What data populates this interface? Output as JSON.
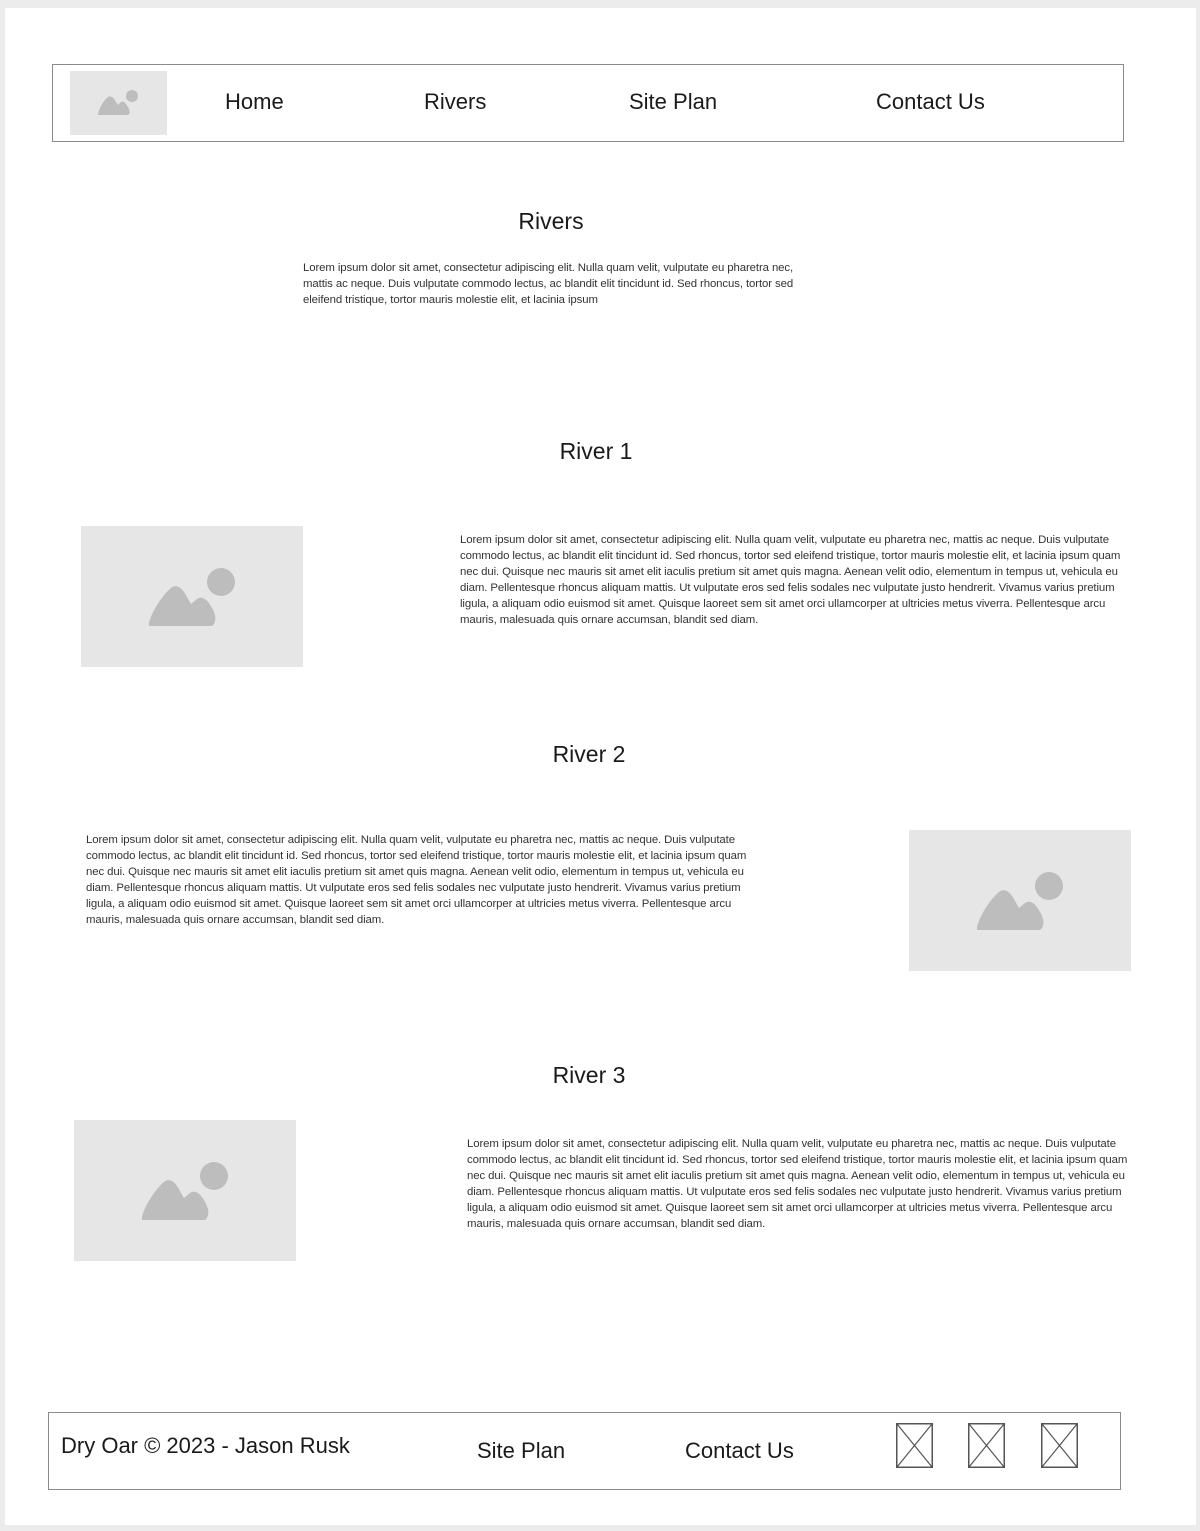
{
  "nav": {
    "links": [
      "Home",
      "Rivers",
      "Site Plan",
      "Contact Us"
    ],
    "logo_icon": "image-placeholder-icon"
  },
  "intro": {
    "title": "Rivers",
    "text": "Lorem ipsum dolor sit amet, consectetur adipiscing elit. Nulla quam velit, vulputate eu pharetra nec, mattis ac neque. Duis vulputate commodo lectus, ac blandit elit tincidunt id. Sed rhoncus, tortor sed eleifend tristique, tortor mauris molestie elit, et lacinia ipsum"
  },
  "rivers": [
    {
      "title": "River 1",
      "text": "Lorem ipsum dolor sit amet, consectetur adipiscing elit. Nulla quam velit, vulputate eu pharetra nec, mattis ac neque. Duis vulputate commodo lectus, ac blandit elit tincidunt id. Sed rhoncus, tortor sed eleifend tristique, tortor mauris molestie elit, et lacinia ipsum quam nec dui. Quisque nec mauris sit amet elit iaculis pretium sit amet quis magna. Aenean velit odio, elementum in tempus ut, vehicula eu diam. Pellentesque rhoncus aliquam mattis. Ut vulputate eros sed felis sodales nec vulputate justo hendrerit. Vivamus varius pretium ligula, a aliquam odio euismod sit amet. Quisque laoreet sem sit amet orci ullamcorper at ultricies metus viverra. Pellentesque arcu mauris, malesuada quis ornare accumsan, blandit sed diam."
    },
    {
      "title": "River 2",
      "text": "Lorem ipsum dolor sit amet, consectetur adipiscing elit. Nulla quam velit, vulputate eu pharetra nec, mattis ac neque. Duis vulputate commodo lectus, ac blandit elit tincidunt id. Sed rhoncus, tortor sed eleifend tristique, tortor mauris molestie elit, et lacinia ipsum quam nec dui. Quisque nec mauris sit amet elit iaculis pretium sit amet quis magna. Aenean velit odio, elementum in tempus ut, vehicula eu diam. Pellentesque rhoncus aliquam mattis. Ut vulputate eros sed felis sodales nec vulputate justo hendrerit. Vivamus varius pretium ligula, a aliquam odio euismod sit amet. Quisque laoreet sem sit amet orci ullamcorper at ultricies metus viverra. Pellentesque arcu mauris, malesuada quis ornare accumsan, blandit sed diam."
    },
    {
      "title": "River 3",
      "text": "Lorem ipsum dolor sit amet, consectetur adipiscing elit. Nulla quam velit, vulputate eu pharetra nec, mattis ac neque. Duis vulputate commodo lectus, ac blandit elit tincidunt id. Sed rhoncus, tortor sed eleifend tristique, tortor mauris molestie elit, et lacinia ipsum quam nec dui. Quisque nec mauris sit amet elit iaculis pretium sit amet quis magna. Aenean velit odio, elementum in tempus ut, vehicula eu diam. Pellentesque rhoncus aliquam mattis. Ut vulputate eros sed felis sodales nec vulputate justo hendrerit. Vivamus varius pretium ligula, a aliquam odio euismod sit amet. Quisque laoreet sem sit amet orci ullamcorper at ultricies metus viverra. Pellentesque arcu mauris, malesuada quis ornare accumsan, blandit sed diam."
    }
  ],
  "footer": {
    "copyright": "Dry Oar © 2023 - Jason Rusk",
    "links": [
      "Site Plan",
      "Contact Us"
    ],
    "social_icons": [
      "social-placeholder-icon",
      "social-placeholder-icon",
      "social-placeholder-icon"
    ]
  },
  "colors": {
    "placeholder_bg": "#e6e6e6",
    "placeholder_icon": "#bdbdbd",
    "border": "#8a8a8a"
  }
}
